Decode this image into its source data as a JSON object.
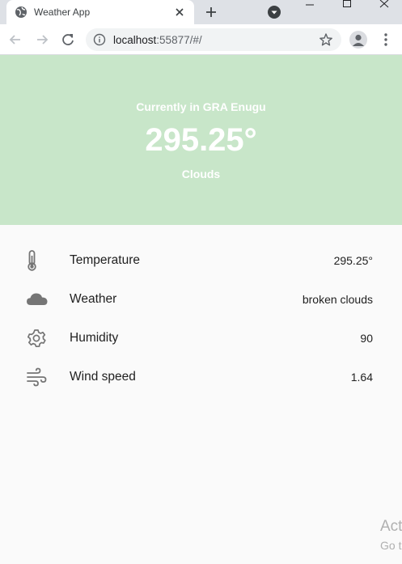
{
  "browser": {
    "tab_title": "Weather App",
    "url_host": "localhost",
    "url_rest": ":55877/#/"
  },
  "weather": {
    "location_text": "Currently in GRA Enugu",
    "temperature": "295.25°",
    "condition": "Clouds",
    "details": [
      {
        "icon": "thermometer-icon",
        "label": "Temperature",
        "value": "295.25°"
      },
      {
        "icon": "cloud-icon",
        "label": "Weather",
        "value": "broken clouds"
      },
      {
        "icon": "gear-icon",
        "label": "Humidity",
        "value": "90"
      },
      {
        "icon": "wind-icon",
        "label": "Wind speed",
        "value": "1.64"
      }
    ]
  },
  "watermark": {
    "title": "Act",
    "subtitle": "Go t"
  },
  "colors": {
    "hero_background": "#c8e6c9",
    "hero_text": "#ffffff",
    "icon_gray": "#757575"
  }
}
